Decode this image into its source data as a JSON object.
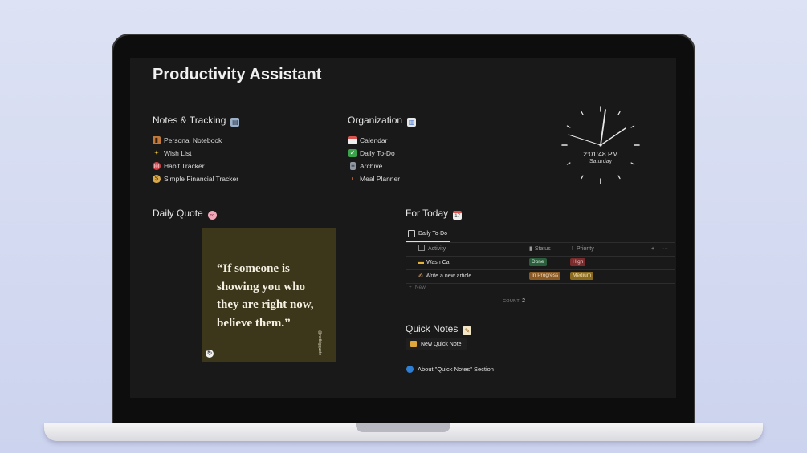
{
  "page": {
    "title": "Productivity Assistant"
  },
  "notes_tracking": {
    "title": "Notes & Tracking",
    "title_icon": "notepad-icon",
    "items": [
      {
        "label": "Personal Notebook",
        "icon": "notebook-icon",
        "color": "#c0793a"
      },
      {
        "label": "Wish List",
        "icon": "sparkles-icon",
        "color": "#e8c23a"
      },
      {
        "label": "Habit Tracker",
        "icon": "target-icon",
        "color": "#d8434a"
      },
      {
        "label": "Simple Financial Tracker",
        "icon": "money-bag-icon",
        "color": "#d9a94a"
      }
    ]
  },
  "organization": {
    "title": "Organization",
    "title_icon": "bar-chart-icon",
    "items": [
      {
        "label": "Calendar",
        "icon": "calendar-icon",
        "color": "#d9534f"
      },
      {
        "label": "Daily To-Do",
        "icon": "check-box-icon",
        "color": "#3aa24a"
      },
      {
        "label": "Archive",
        "icon": "file-cabinet-icon",
        "color": "#8f97a3"
      },
      {
        "label": "Meal Planner",
        "icon": "drumstick-icon",
        "color": "#c8643c"
      }
    ]
  },
  "clock": {
    "time": "2:01:48 PM",
    "day": "Saturday"
  },
  "daily_quote": {
    "title": "Daily Quote",
    "title_icon": "brain-icon",
    "quote": "“If someone is showing you who they are right now, believe them.”",
    "handle": "@notbigquote"
  },
  "for_today": {
    "title": "For Today",
    "title_icon": "calendar-icon",
    "tab": "Daily To-Do",
    "columns": {
      "activity": "Activity",
      "status": "Status",
      "priority": "Priority"
    },
    "rows": [
      {
        "activity": "Wash Car",
        "activity_icon": "sponge-icon",
        "status": "Done",
        "status_color": "#2b5e3c",
        "priority": "High",
        "priority_color": "#7a2c2c"
      },
      {
        "activity": "Write a new article",
        "activity_icon": "writing-hand-icon",
        "status": "In Progress",
        "status_color": "#8a5a25",
        "priority": "Medium",
        "priority_color": "#8a6a1e"
      }
    ],
    "new_label": "New",
    "count_label": "COUNT",
    "count_value": "2"
  },
  "quick_notes": {
    "title": "Quick Notes",
    "title_icon": "memo-icon",
    "button": "New Quick Note",
    "about": "About \"Quick Notes\" Section"
  }
}
